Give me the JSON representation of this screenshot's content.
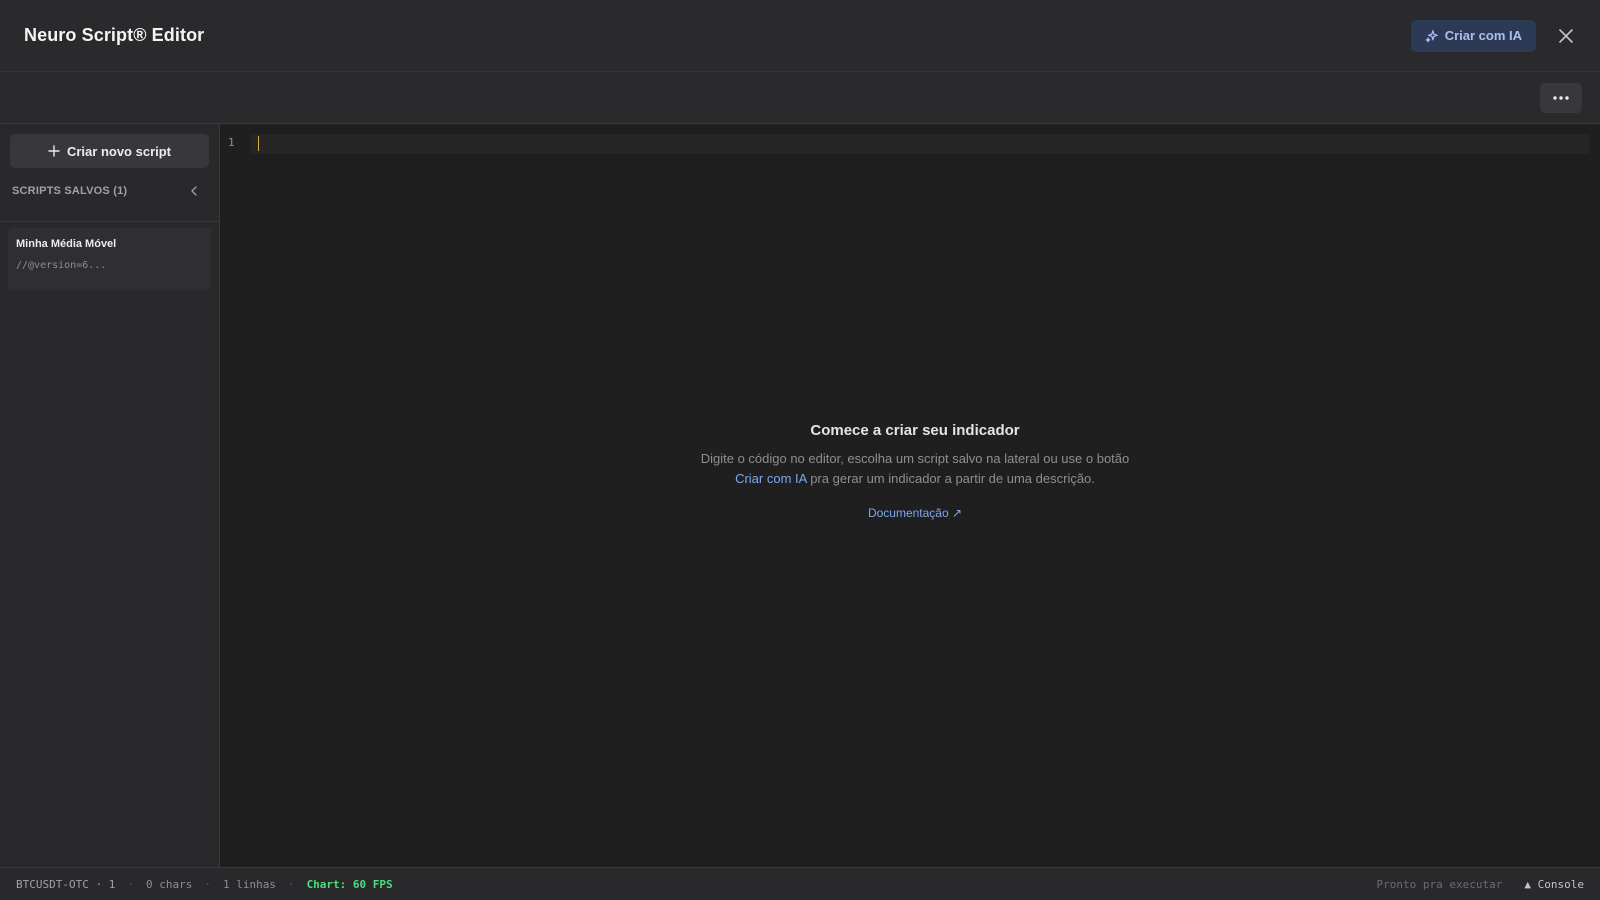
{
  "header": {
    "title": "Neuro Script® Editor",
    "ai_button_label": "Criar com IA",
    "ai_icon": "sparkle-icon",
    "close_icon": "close-icon"
  },
  "toolbar": {
    "more_icon": "more-horizontal-icon"
  },
  "sidebar": {
    "new_script_label": "Criar novo script",
    "saved_header": "SCRIPTS SALVOS (1)",
    "scripts": [
      {
        "name": "Minha Média Móvel",
        "preview": "//@version=6..."
      }
    ]
  },
  "editor": {
    "line_number": "1"
  },
  "empty_state": {
    "title": "Comece a criar seu indicador",
    "desc_before": "Digite o código no editor, escolha um script salvo na lateral ou use o botão ",
    "desc_link": "Criar com IA",
    "desc_after": " pra gerar um indicador a partir de uma descrição.",
    "doc_link": "Documentação ↗"
  },
  "statusbar": {
    "symbol": "BTCUSDT-OTC · 1",
    "chars": "0 chars",
    "lines": "1 linhas",
    "fps": "Chart: 60 FPS",
    "status": "Pronto pra executar",
    "console": "▲ Console",
    "separator": "·"
  },
  "colors": {
    "accent": "#7ea6f0",
    "fps_green": "#4ade80",
    "cursor": "#e0a83a"
  }
}
